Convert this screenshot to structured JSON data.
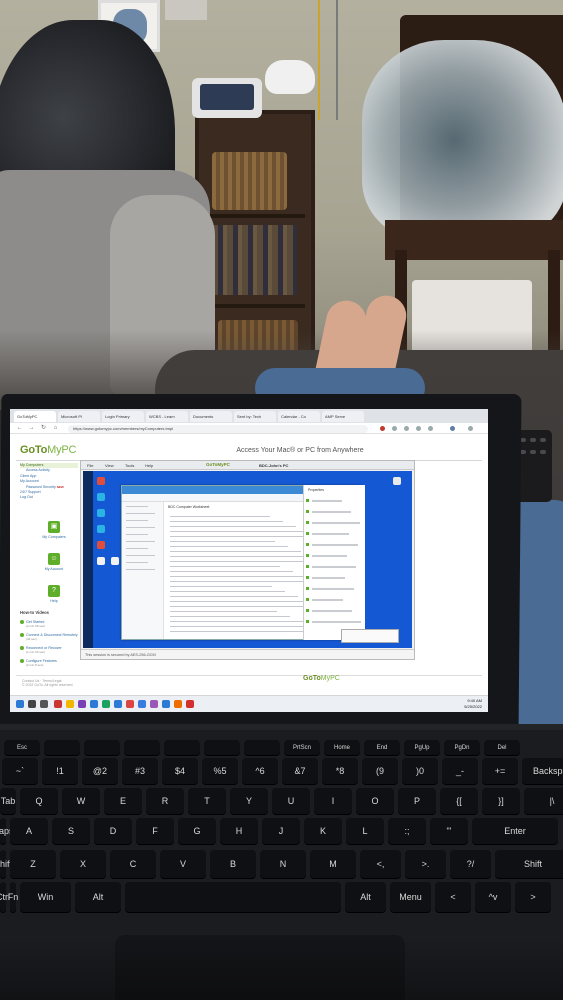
{
  "browser": {
    "tabs": [
      {
        "label": "GoToMyPC"
      },
      {
        "label": "Microsoft Pl"
      },
      {
        "label": "Login Primary"
      },
      {
        "label": "WCBS - Learn"
      },
      {
        "label": "Documents"
      },
      {
        "label": "Sent by: Tech"
      },
      {
        "label": "Calendar - Co"
      },
      {
        "label": "AMP Serve"
      }
    ],
    "url": "https://www.gotomypc.com/members/myComputers.tmpl"
  },
  "gotomypc": {
    "logo_main": "GoTo",
    "logo_my": "MyPC",
    "page_title": "Access Your Mac® or PC from Anywhere",
    "nav": [
      {
        "label": "My Computers"
      },
      {
        "label": "Access Activity"
      },
      {
        "label": "Client App"
      },
      {
        "label": "My Account"
      },
      {
        "label": "Password Security"
      },
      {
        "label": "24/7 Support"
      },
      {
        "label": "Log Out"
      }
    ],
    "nav_new_badge": "NEW",
    "tiles": [
      {
        "label": "My Computers",
        "icon": "monitor-icon"
      },
      {
        "label": "My Account",
        "icon": "person-icon"
      },
      {
        "label": "Help",
        "icon": "question-icon"
      }
    ],
    "videos_title": "How-to Videos",
    "videos": [
      {
        "label": "Get Started",
        "duration": "(2 min 06 sec)"
      },
      {
        "label": "Connect & Disconnect Remotely",
        "duration": "(43 sec)"
      },
      {
        "label": "Reconnect or Recover",
        "duration": "(1 min 33 sec)"
      },
      {
        "label": "Configure Features",
        "duration": "(2 min 8 sec)"
      }
    ],
    "footer_text": "Contact Us · Terms/Legal",
    "footer_copyright": "© 2022 GoTo. All rights reserved.",
    "footer_logo_main": "GoTo",
    "footer_logo_my": "MyPC"
  },
  "viewer": {
    "menus": [
      "File",
      "View",
      "Tools",
      "Help"
    ],
    "logo": "GoToMyPC",
    "title": "BDC-John's PC",
    "explorer_title": "Windows",
    "explorer_heading": "BDC Computer Worksheet",
    "properties_title": "Properties",
    "status_text": "This session is secured by AES-256-GCM"
  },
  "windows_taskbar": {
    "time": "9:40 AM",
    "date": "5/25/2022"
  },
  "keyboard": {
    "fn_row": [
      "Esc",
      "",
      "",
      "",
      "",
      "",
      "",
      "PrtScn",
      "Home",
      "End",
      "PgUp",
      "PgDn",
      "Del"
    ],
    "num_row": [
      "~`",
      "!1",
      "@2",
      "#3",
      "$4",
      "%5",
      "^6",
      "&7",
      "*8",
      "(9",
      ")0",
      "_-",
      "+=",
      "Backspace"
    ],
    "row_q": [
      "Tab",
      "Q",
      "W",
      "E",
      "R",
      "T",
      "Y",
      "U",
      "I",
      "O",
      "P",
      "{[",
      "}]",
      "|\\"
    ],
    "row_a": [
      "Caps",
      "A",
      "S",
      "D",
      "F",
      "G",
      "H",
      "J",
      "K",
      "L",
      ":;",
      "\"'",
      "Enter"
    ],
    "row_z": [
      "Shift",
      "Z",
      "X",
      "C",
      "V",
      "B",
      "N",
      "M",
      "<,",
      ">.",
      "?/",
      "Shift"
    ],
    "row_bottom": [
      "Ctrl",
      "Fn",
      "Win",
      "Alt",
      "",
      "Alt",
      "Menu",
      "<",
      "^v",
      ">"
    ]
  },
  "colors": {
    "gotomypc_green": "#6b8e23",
    "remote_desktop_blue": "#1458d4",
    "link_blue": "#2f6aa3"
  }
}
